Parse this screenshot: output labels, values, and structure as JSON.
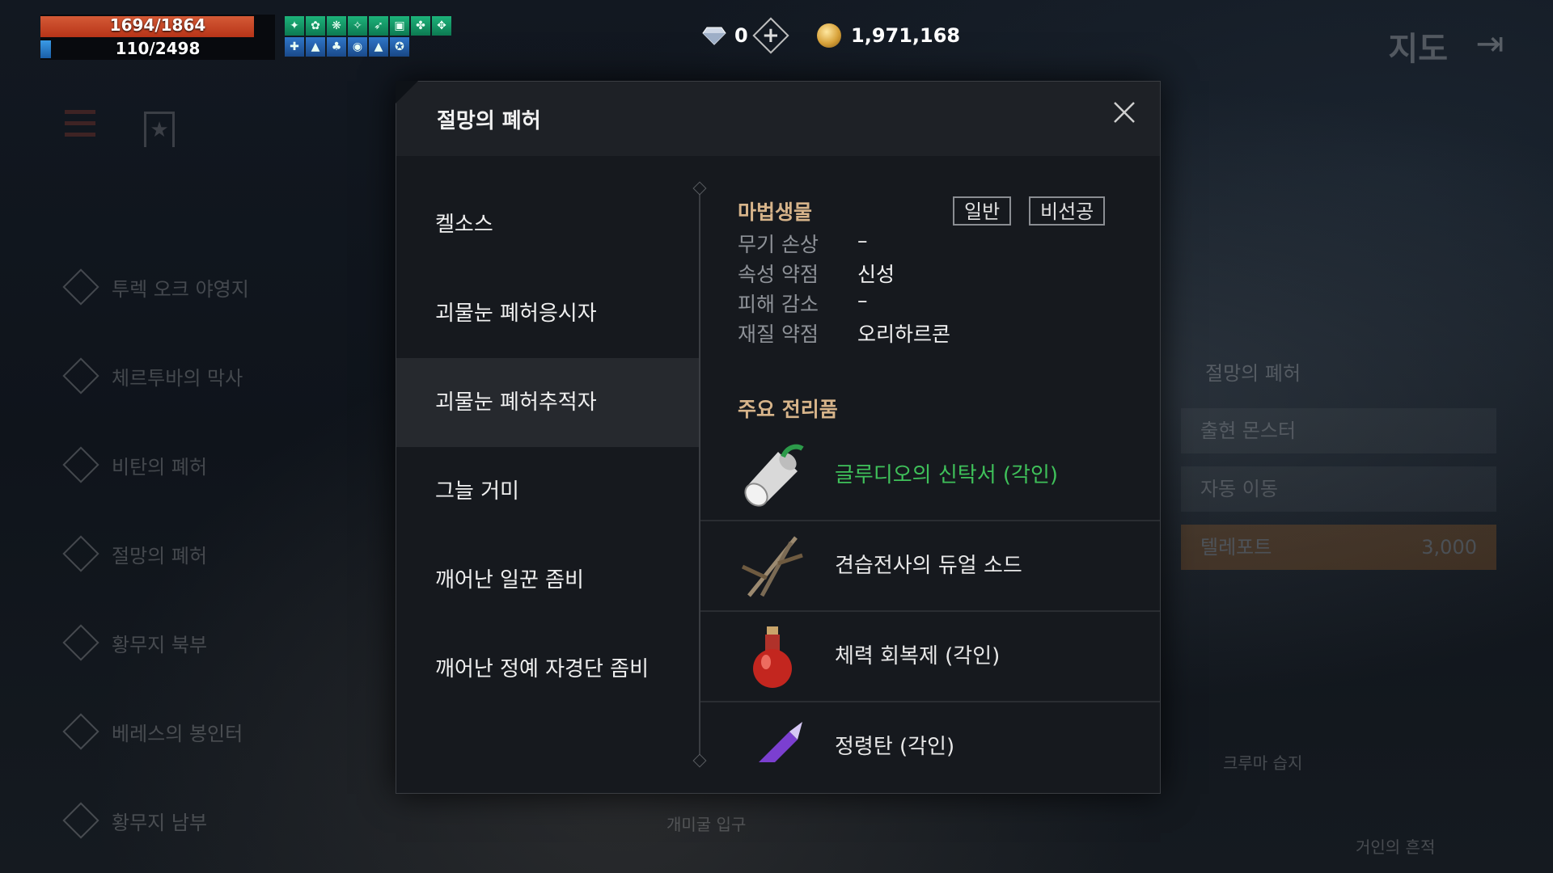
{
  "hud": {
    "hp_text": "1694/1864",
    "hp_fraction": 0.909,
    "mp_text": "110/2498",
    "mp_fraction": 0.044,
    "gems": "0",
    "gold": "1,971,168",
    "map_title": "지도",
    "colors": {
      "hp": "#c4431f",
      "mp": "#2a7fcf",
      "buff": "#169a66"
    }
  },
  "background": {
    "region_list": [
      "투렉 오크 야영지",
      "체르투바의 막사",
      "비탄의 폐허",
      "절망의 폐허",
      "황무지 북부",
      "베레스의 봉인터",
      "황무지 남부"
    ],
    "right_panel": {
      "title": "절망의 폐허",
      "rows": [
        "출현 몬스터",
        "자동 이동"
      ],
      "teleport_label": "텔레포트",
      "teleport_cost": "3,000"
    },
    "map_labels": [
      "크루마 습지",
      "개미굴 입구",
      "거인의 흔적"
    ]
  },
  "modal": {
    "title": "절망의 폐허",
    "monsters": [
      {
        "name": "켈소스",
        "selected": false
      },
      {
        "name": "괴물눈 폐허응시자",
        "selected": false
      },
      {
        "name": "괴물눈 폐허추적자",
        "selected": true
      },
      {
        "name": "그늘 거미",
        "selected": false
      },
      {
        "name": "깨어난 일꾼 좀비",
        "selected": false
      },
      {
        "name": "깨어난 정예 자경단 좀비",
        "selected": false
      }
    ],
    "detail": {
      "type": "마법생물",
      "tags": [
        "일반",
        "비선공"
      ],
      "stats": [
        {
          "label": "무기 손상",
          "value": "–"
        },
        {
          "label": "속성 약점",
          "value": "신성"
        },
        {
          "label": "피해 감소",
          "value": "–"
        },
        {
          "label": "재질 약점",
          "value": "오리하르콘"
        }
      ],
      "loot_title": "주요 전리품",
      "loot": [
        {
          "name": "글루디오의 신탁서 (각인)",
          "icon": "scroll-icon",
          "color": "#3fc15a"
        },
        {
          "name": "견습전사의 듀얼 소드",
          "icon": "dual-sword-icon",
          "color": "#e8e8e8"
        },
        {
          "name": "체력 회복제 (각인)",
          "icon": "potion-icon",
          "color": "#e8e8e8"
        },
        {
          "name": "정령탄 (각인)",
          "icon": "spiritshot-icon",
          "color": "#e8e8e8"
        }
      ]
    }
  }
}
